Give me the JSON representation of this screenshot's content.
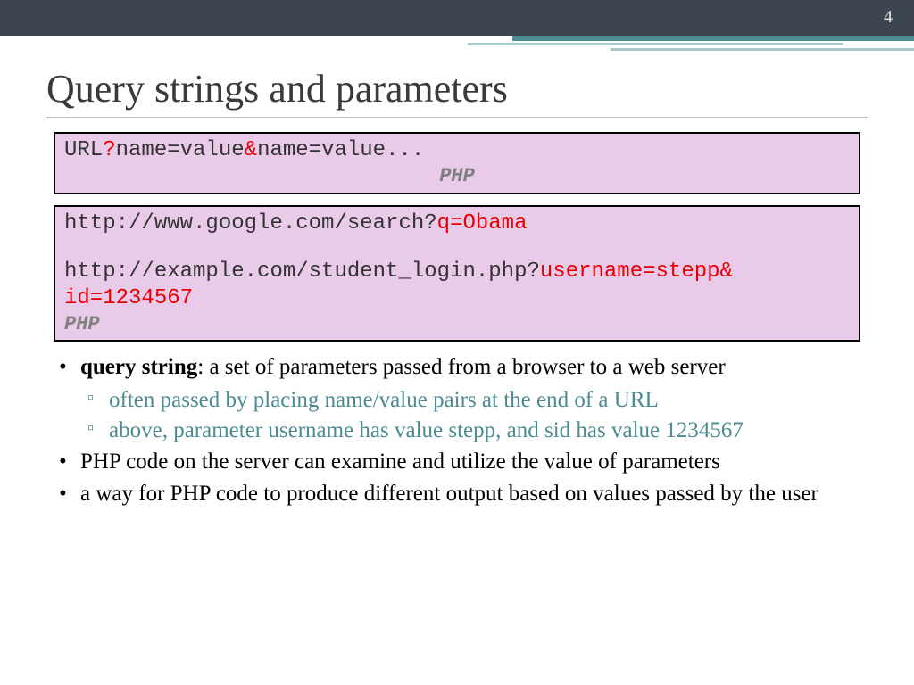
{
  "page_number": "4",
  "title": "Query strings and parameters",
  "code1": {
    "p1": "URL",
    "p2": "?",
    "p3": "name=value",
    "p4": "&",
    "p5": "name=value...",
    "label": "PHP"
  },
  "code2": {
    "line1a": "http://www.google.com/search?",
    "line1b": "q=Obama",
    "line2a": "http://example.com/student_login.php?",
    "line2b": "username=stepp",
    "line2c": "&",
    "line3a": "id=1234567",
    "label": "PHP"
  },
  "bullets": {
    "b1_strong": "query string",
    "b1_rest": ": a set of parameters passed from a browser to a web server",
    "b1a": "often passed by placing name/value pairs at the end of a URL",
    "b1b": "above, parameter username has value stepp, and sid has value 1234567",
    "b2": "PHP code on the server can examine and utilize the value of parameters",
    "b3": "a way for PHP code to produce different output based on values passed by the user"
  }
}
